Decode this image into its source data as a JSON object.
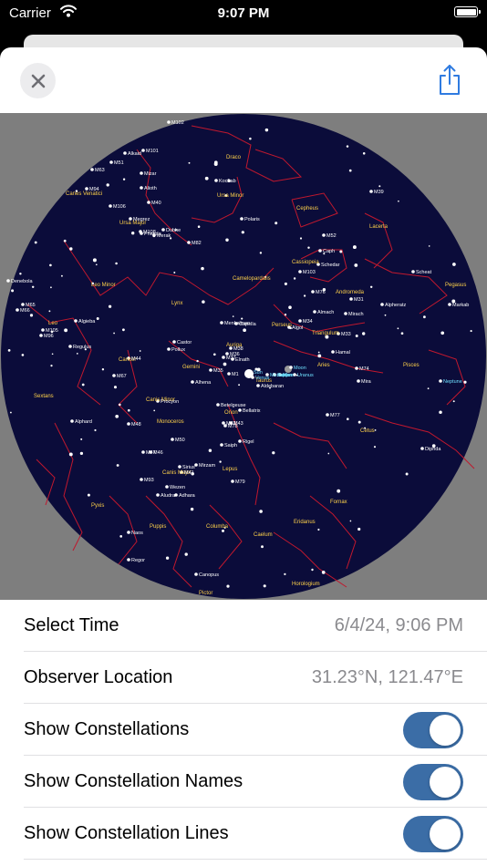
{
  "status_bar": {
    "carrier": "Carrier",
    "time": "9:07 PM",
    "battery_level": 1.0
  },
  "sky": {
    "colors": {
      "background": "#0b0c3a",
      "outer": "#7e7e7e",
      "lines": "#c0182e",
      "stars": "#ffffff",
      "names": "#ffd24a",
      "objects": "#ffffff",
      "planets": "#6fe0ff"
    },
    "constellation_names": [
      {
        "id": "draco",
        "text": "Draco"
      },
      {
        "id": "ursa-minor",
        "text": "Ursa Minor"
      },
      {
        "id": "cepheus",
        "text": "Cepheus"
      },
      {
        "id": "lacerta",
        "text": "Lacerta"
      },
      {
        "id": "ursa-major",
        "text": "Ursa Major"
      },
      {
        "id": "canes-venatici",
        "text": "Canes Venatici"
      },
      {
        "id": "camelopardalis",
        "text": "Camelopardalis"
      },
      {
        "id": "cassiopeia",
        "text": "Cassiopeia"
      },
      {
        "id": "pegasus",
        "text": "Pegasus"
      },
      {
        "id": "leo-minor",
        "text": "Leo Minor"
      },
      {
        "id": "lynx",
        "text": "Lynx"
      },
      {
        "id": "andromeda",
        "text": "Andromeda"
      },
      {
        "id": "perseus",
        "text": "Perseus"
      },
      {
        "id": "auriga",
        "text": "Auriga"
      },
      {
        "id": "triangulum",
        "text": "Triangulum"
      },
      {
        "id": "leo",
        "text": "Leo"
      },
      {
        "id": "aries",
        "text": "Aries"
      },
      {
        "id": "pisces",
        "text": "Pisces"
      },
      {
        "id": "cancer",
        "text": "Cancer"
      },
      {
        "id": "gemini",
        "text": "Gemini"
      },
      {
        "id": "taurus",
        "text": "Taurus"
      },
      {
        "id": "sextans",
        "text": "Sextans"
      },
      {
        "id": "canis-minor",
        "text": "Canis Minor"
      },
      {
        "id": "orion",
        "text": "Orion"
      },
      {
        "id": "monoceros",
        "text": "Monoceros"
      },
      {
        "id": "cetus",
        "text": "Cetus"
      },
      {
        "id": "canis-major",
        "text": "Canis Major"
      },
      {
        "id": "lepus",
        "text": "Lepus"
      },
      {
        "id": "fornax",
        "text": "Fornax"
      },
      {
        "id": "eridanus",
        "text": "Eridanus"
      },
      {
        "id": "pyxis",
        "text": "Pyxis"
      },
      {
        "id": "puppis",
        "text": "Puppis"
      },
      {
        "id": "columba",
        "text": "Columba"
      },
      {
        "id": "caelum",
        "text": "Caelum"
      },
      {
        "id": "horologium",
        "text": "Horologium"
      },
      {
        "id": "pictor",
        "text": "Pictor"
      }
    ],
    "object_labels": [
      {
        "id": "m102",
        "text": "M102"
      },
      {
        "id": "m101",
        "text": "M101"
      },
      {
        "id": "alkaid",
        "text": "Alkaid"
      },
      {
        "id": "m51",
        "text": "M51"
      },
      {
        "id": "mizar",
        "text": "Mizar"
      },
      {
        "id": "m63",
        "text": "M63"
      },
      {
        "id": "m94",
        "text": "M94"
      },
      {
        "id": "alioth",
        "text": "Alioth"
      },
      {
        "id": "m106",
        "text": "M106"
      },
      {
        "id": "m40",
        "text": "M40"
      },
      {
        "id": "megrez",
        "text": "Megrez"
      },
      {
        "id": "phecda",
        "text": "Phecda"
      },
      {
        "id": "merak",
        "text": "Merak"
      },
      {
        "id": "m108",
        "text": "M108"
      },
      {
        "id": "dubhe",
        "text": "Dubhe"
      },
      {
        "id": "m82",
        "text": "M82"
      },
      {
        "id": "kochab",
        "text": "Kochab"
      },
      {
        "id": "polaris",
        "text": "Polaris"
      },
      {
        "id": "m52",
        "text": "M52"
      },
      {
        "id": "m39",
        "text": "M39"
      },
      {
        "id": "caph",
        "text": "Caph"
      },
      {
        "id": "schedar",
        "text": "Schedar"
      },
      {
        "id": "m103",
        "text": "M103"
      },
      {
        "id": "scheat",
        "text": "Scheat"
      },
      {
        "id": "m76",
        "text": "M76"
      },
      {
        "id": "m31",
        "text": "M31"
      },
      {
        "id": "markab",
        "text": "Markab"
      },
      {
        "id": "almach",
        "text": "Almach"
      },
      {
        "id": "mirach",
        "text": "Mirach"
      },
      {
        "id": "alpheratz",
        "text": "Alpheratz"
      },
      {
        "id": "m34",
        "text": "M34"
      },
      {
        "id": "algol",
        "text": "Algol"
      },
      {
        "id": "m33",
        "text": "M33"
      },
      {
        "id": "hamal",
        "text": "Hamal"
      },
      {
        "id": "m74",
        "text": "M74"
      },
      {
        "id": "mira",
        "text": "Mira"
      },
      {
        "id": "neptune",
        "text": "Neptune"
      },
      {
        "id": "denebola",
        "text": "Denebola"
      },
      {
        "id": "m65",
        "text": "M65"
      },
      {
        "id": "m66",
        "text": "M66"
      },
      {
        "id": "algieba",
        "text": "Algieba"
      },
      {
        "id": "regulus",
        "text": "Regulus"
      },
      {
        "id": "m105",
        "text": "M105"
      },
      {
        "id": "m96",
        "text": "M96"
      },
      {
        "id": "capella",
        "text": "Capella"
      },
      {
        "id": "menkalinan",
        "text": "Menkalinan"
      },
      {
        "id": "castor",
        "text": "Castor"
      },
      {
        "id": "pollux",
        "text": "Pollux"
      },
      {
        "id": "m38",
        "text": "M38"
      },
      {
        "id": "m36",
        "text": "M36"
      },
      {
        "id": "m37",
        "text": "M37"
      },
      {
        "id": "elnath",
        "text": "Elnath"
      },
      {
        "id": "m35",
        "text": "M35"
      },
      {
        "id": "m1",
        "text": "M1"
      },
      {
        "id": "alhena",
        "text": "Alhena"
      },
      {
        "id": "m44",
        "text": "M44"
      },
      {
        "id": "m67",
        "text": "M67"
      },
      {
        "id": "procyon",
        "text": "Procyon"
      },
      {
        "id": "sun",
        "text": "Sun"
      },
      {
        "id": "venus",
        "text": "Venus"
      },
      {
        "id": "mercury",
        "text": "Mercury"
      },
      {
        "id": "jupiter",
        "text": "Jupiter"
      },
      {
        "id": "moon",
        "text": "Moon"
      },
      {
        "id": "mars",
        "text": "Mars"
      },
      {
        "id": "uranus",
        "text": "Uranus"
      },
      {
        "id": "saturn",
        "text": "Saturn"
      },
      {
        "id": "aldebaran",
        "text": "Aldebaran"
      },
      {
        "id": "betelgeuse",
        "text": "Betelgeuse"
      },
      {
        "id": "bellatrix",
        "text": "Bellatrix"
      },
      {
        "id": "m42",
        "text": "M42"
      },
      {
        "id": "m43",
        "text": "M43"
      },
      {
        "id": "m78",
        "text": "M78"
      },
      {
        "id": "saiph",
        "text": "Saiph"
      },
      {
        "id": "rigel",
        "text": "Rigel"
      },
      {
        "id": "m77",
        "text": "M77"
      },
      {
        "id": "diphda",
        "text": "Diphda"
      },
      {
        "id": "m48",
        "text": "M48"
      },
      {
        "id": "m50",
        "text": "M50"
      },
      {
        "id": "m47",
        "text": "M47"
      },
      {
        "id": "m46",
        "text": "M46"
      },
      {
        "id": "sirius",
        "text": "Sirius"
      },
      {
        "id": "m41",
        "text": "M41"
      },
      {
        "id": "mirzam",
        "text": "Mirzam"
      },
      {
        "id": "m79",
        "text": "M79"
      },
      {
        "id": "m93",
        "text": "M93"
      },
      {
        "id": "wezen",
        "text": "Wezen"
      },
      {
        "id": "aludra",
        "text": "Aludra"
      },
      {
        "id": "adhara",
        "text": "Adhara"
      },
      {
        "id": "naos",
        "text": "Naos"
      },
      {
        "id": "regor",
        "text": "Regor"
      },
      {
        "id": "canopus",
        "text": "Canopus"
      },
      {
        "id": "alphard",
        "text": "Alphard"
      }
    ]
  },
  "settings": {
    "select_time": {
      "label": "Select Time",
      "value": "6/4/24, 9:06 PM"
    },
    "observer_location": {
      "label": "Observer Location",
      "value": "31.23°N, 121.47°E"
    },
    "show_constellations": {
      "label": "Show Constellations",
      "on": true
    },
    "show_constellation_names": {
      "label": "Show Constellation Names",
      "on": true
    },
    "show_constellation_lines": {
      "label": "Show Constellation Lines",
      "on": true
    }
  }
}
